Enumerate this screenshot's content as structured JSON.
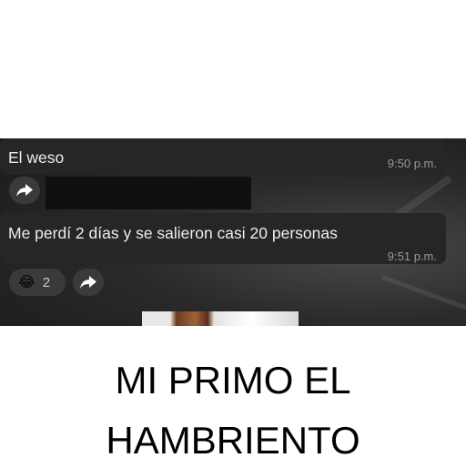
{
  "messages": [
    {
      "text": "El weso",
      "time": "9:50 p.m."
    },
    {
      "text": "Me perdí 2 días y se salieron casi 20 personas",
      "time": "9:51 p.m."
    }
  ],
  "reaction": {
    "emoji": "😂",
    "count": "2"
  },
  "icons": {
    "forward": "forward-arrow-icon",
    "reaction": "laughing-emoji-icon"
  },
  "caption": {
    "line1": "MI PRIMO EL",
    "line2": "HAMBRIENTO"
  },
  "colors": {
    "chat_bg": "#1f1f1f",
    "bubble": "#262626",
    "text": "#ededed",
    "time": "#9a9a9a"
  }
}
